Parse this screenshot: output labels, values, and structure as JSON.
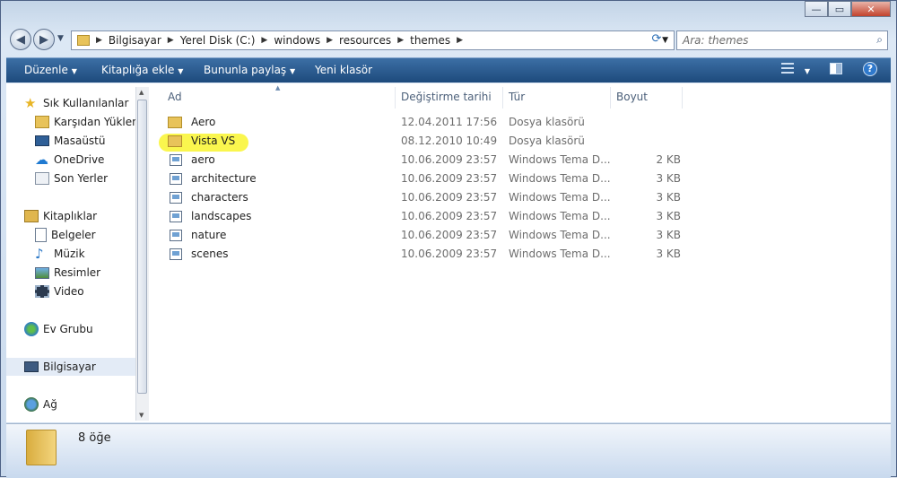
{
  "window": {
    "caption_buttons": [
      "—",
      "▭",
      "✕"
    ]
  },
  "address_bar": {
    "breadcrumbs": [
      "Bilgisayar",
      "Yerel Disk (C:)",
      "windows",
      "resources",
      "themes"
    ],
    "refresh_icon": "refresh-icon"
  },
  "search": {
    "placeholder": "Ara: themes"
  },
  "toolbar": {
    "organize": "Düzenle",
    "include_library": "Kitaplığa ekle",
    "share": "Bununla paylaş",
    "new_folder": "Yeni klasör"
  },
  "nav_pane": {
    "favorites": "Sık Kullanılanlar",
    "downloads": "Karşıdan Yüklem",
    "desktop": "Masaüstü",
    "onedrive": "OneDrive",
    "recent": "Son Yerler",
    "libraries": "Kitaplıklar",
    "documents": "Belgeler",
    "music": "Müzik",
    "pictures": "Resimler",
    "videos": "Video",
    "homegroup": "Ev Grubu",
    "computer": "Bilgisayar",
    "network": "Ağ"
  },
  "columns": {
    "name": "Ad",
    "modified": "Değiştirme tarihi",
    "type": "Tür",
    "size": "Boyut"
  },
  "files": [
    {
      "name": "Aero",
      "date": "12.04.2011 17:56",
      "type": "Dosya klasörü",
      "size": "",
      "kind": "folder"
    },
    {
      "name": "Vista VS",
      "date": "08.12.2010 10:49",
      "type": "Dosya klasörü",
      "size": "",
      "kind": "folder",
      "highlighted": true
    },
    {
      "name": "aero",
      "date": "10.06.2009 23:57",
      "type": "Windows Tema D...",
      "size": "2 KB",
      "kind": "theme"
    },
    {
      "name": "architecture",
      "date": "10.06.2009 23:57",
      "type": "Windows Tema D...",
      "size": "3 KB",
      "kind": "theme"
    },
    {
      "name": "characters",
      "date": "10.06.2009 23:57",
      "type": "Windows Tema D...",
      "size": "3 KB",
      "kind": "theme"
    },
    {
      "name": "landscapes",
      "date": "10.06.2009 23:57",
      "type": "Windows Tema D...",
      "size": "3 KB",
      "kind": "theme"
    },
    {
      "name": "nature",
      "date": "10.06.2009 23:57",
      "type": "Windows Tema D...",
      "size": "3 KB",
      "kind": "theme"
    },
    {
      "name": "scenes",
      "date": "10.06.2009 23:57",
      "type": "Windows Tema D...",
      "size": "3 KB",
      "kind": "theme"
    }
  ],
  "status": {
    "count": "8 öğe"
  },
  "colors": {
    "highlight": "#f9f53b",
    "toolbar": "#1d4a7c",
    "folder": "#e8c35a"
  }
}
